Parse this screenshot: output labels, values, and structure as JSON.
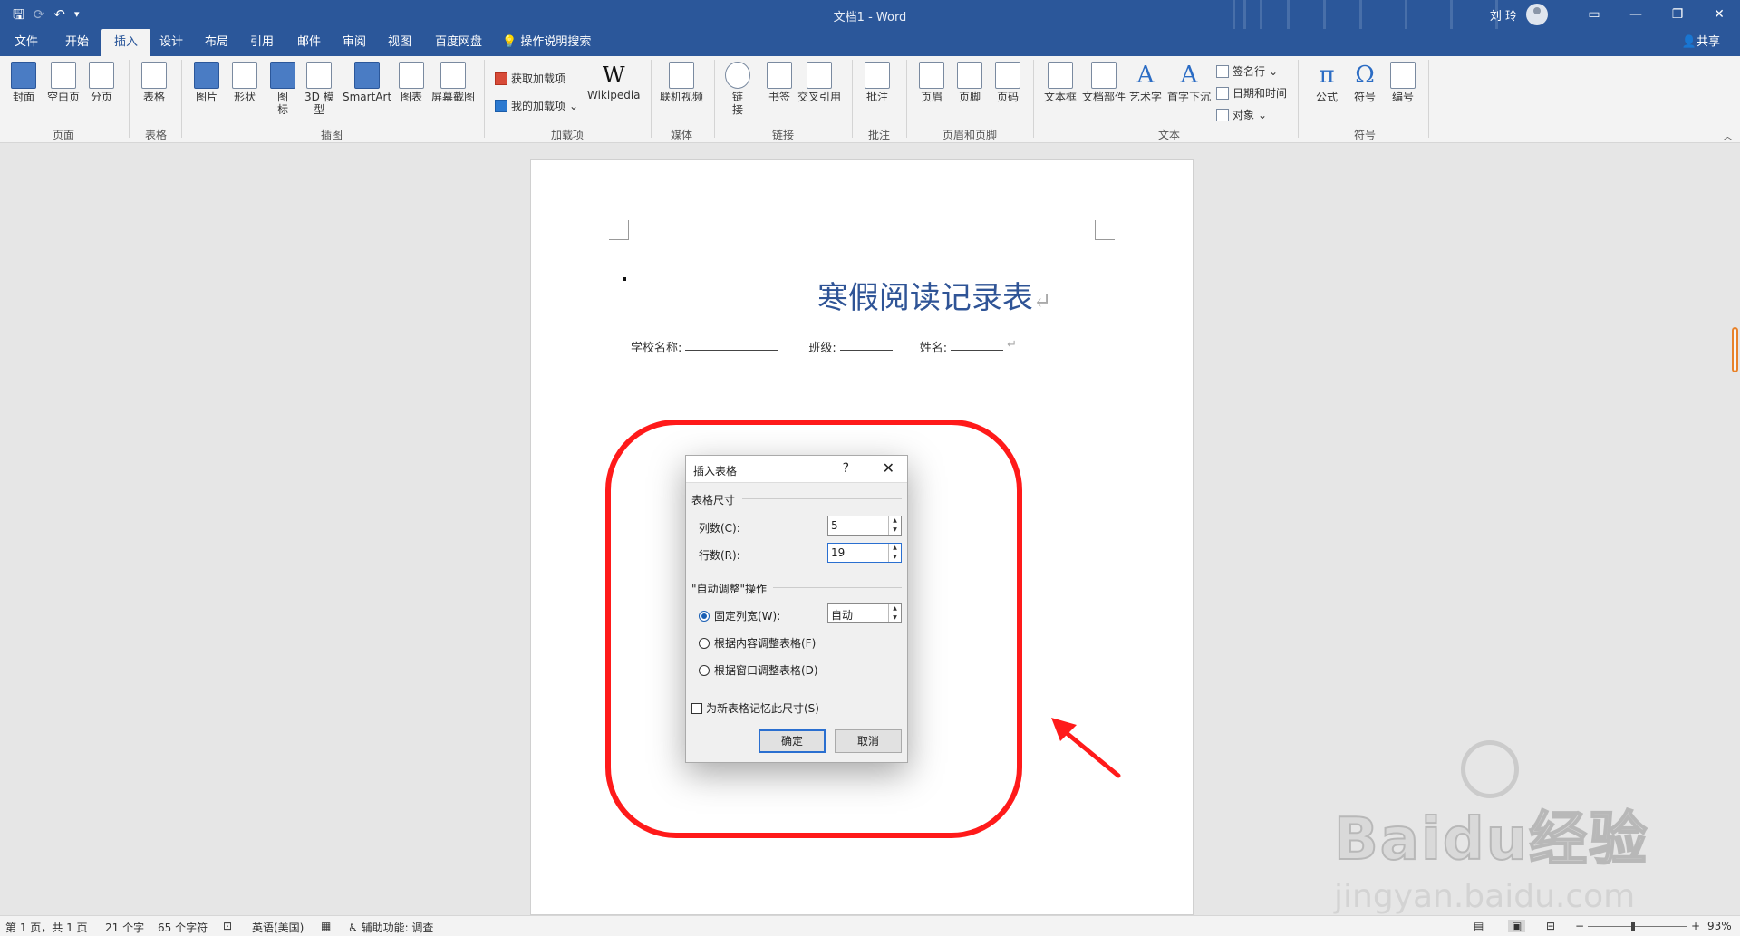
{
  "titlebar": {
    "doc_title": "文档1 - Word",
    "user": "刘 玲",
    "qat": [
      "save-icon",
      "autosave-icon",
      "undo-icon",
      "customize-icon"
    ]
  },
  "tabs": [
    "文件",
    "开始",
    "插入",
    "设计",
    "布局",
    "引用",
    "邮件",
    "审阅",
    "视图",
    "百度网盘"
  ],
  "active_tab": "插入",
  "tell_me": "操作说明搜索",
  "share": "共享",
  "ribbon": {
    "pages": {
      "cover": "封面",
      "blank": "空白页",
      "break": "分页",
      "group": "页面"
    },
    "tables": {
      "table": "表格",
      "group": "表格"
    },
    "illustrations": {
      "picture": "图片",
      "shapes": "形状",
      "icons": "图\n标",
      "model3d": "3D 模\n型",
      "smartart": "SmartArt",
      "chart": "图表",
      "screenshot": "屏幕截图",
      "group": "插图"
    },
    "addins": {
      "get": "获取加载项",
      "mine": "我的加载项",
      "wiki": "Wikipedia",
      "group": "加载项"
    },
    "media": {
      "video": "联机视频",
      "group": "媒体"
    },
    "links": {
      "link": "链\n接",
      "bookmark": "书签",
      "crossref": "交叉引用",
      "group": "链接"
    },
    "comments": {
      "comment": "批注",
      "group": "批注"
    },
    "headerfooter": {
      "header": "页眉",
      "footer": "页脚",
      "pagenum": "页码",
      "group": "页眉和页脚"
    },
    "text": {
      "textbox": "文本框",
      "quickparts": "文档部件",
      "wordart": "艺术字",
      "dropcap": "首字下沉",
      "sigline": "签名行",
      "datetime": "日期和时间",
      "object": "对象",
      "group": "文本"
    },
    "symbols": {
      "equation": "公式",
      "symbol": "符号",
      "number": "编号",
      "group": "符号"
    }
  },
  "document": {
    "heading": "寒假阅读记录表",
    "school_label": "学校名称:",
    "class_label": "班级:",
    "name_label": "姓名:"
  },
  "dialog": {
    "title": "插入表格",
    "help": "?",
    "close": "✕",
    "size_section": "表格尺寸",
    "columns_label": "列数(C):",
    "columns_value": "5",
    "rows_label": "行数(R):",
    "rows_value": "19",
    "autofit_section": "\"自动调整\"操作",
    "fixed_label": "固定列宽(W):",
    "fixed_value": "自动",
    "content_label": "根据内容调整表格(F)",
    "window_label": "根据窗口调整表格(D)",
    "remember_label": "为新表格记忆此尺寸(S)",
    "ok": "确定",
    "cancel": "取消"
  },
  "statusbar": {
    "page": "第 1 页，共 1 页",
    "words": "21 个字",
    "chars": "65 个字符",
    "lang": "英语(美国)",
    "accessibility": "辅助功能: 调查",
    "zoom": "93%"
  },
  "watermark": {
    "brand": "Baidu经验",
    "url": "jingyan.baidu.com"
  },
  "colors": {
    "accent": "#2b579a",
    "annotation": "#ff1a1a",
    "heading": "#2f5496"
  }
}
